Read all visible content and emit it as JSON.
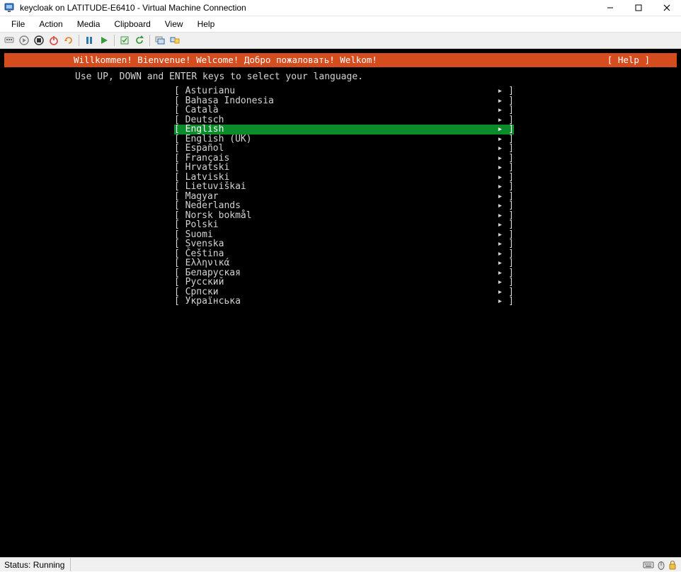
{
  "window": {
    "title": "keycloak on LATITUDE-E6410 - Virtual Machine Connection"
  },
  "menu": {
    "items": [
      "File",
      "Action",
      "Media",
      "Clipboard",
      "View",
      "Help"
    ]
  },
  "toolbar": {
    "icons": [
      "ctrl-alt-del",
      "start",
      "turnoff",
      "shutdown",
      "reset",
      "sep",
      "pause",
      "play",
      "sep",
      "checkpoint",
      "revert",
      "sep",
      "enhanced",
      "share"
    ]
  },
  "console": {
    "header_welcome": "Willkommen! Bienvenue! Welcome! Добро пожаловать! Welkom!",
    "header_help": "[ Help ]",
    "instruction": "Use UP, DOWN and ENTER keys to select your language.",
    "languages": [
      {
        "name": "Asturianu",
        "selected": false
      },
      {
        "name": "Bahasa Indonesia",
        "selected": false
      },
      {
        "name": "Català",
        "selected": false
      },
      {
        "name": "Deutsch",
        "selected": false
      },
      {
        "name": "English",
        "selected": true
      },
      {
        "name": "English (UK)",
        "selected": false
      },
      {
        "name": "Español",
        "selected": false
      },
      {
        "name": "Français",
        "selected": false
      },
      {
        "name": "Hrvatski",
        "selected": false
      },
      {
        "name": "Latviski",
        "selected": false
      },
      {
        "name": "Lietuviškai",
        "selected": false
      },
      {
        "name": "Magyar",
        "selected": false
      },
      {
        "name": "Nederlands",
        "selected": false
      },
      {
        "name": "Norsk bokmål",
        "selected": false
      },
      {
        "name": "Polski",
        "selected": false
      },
      {
        "name": "Suomi",
        "selected": false
      },
      {
        "name": "Svenska",
        "selected": false
      },
      {
        "name": "Čeština",
        "selected": false
      },
      {
        "name": "Ελληνικά",
        "selected": false
      },
      {
        "name": "Беларуская",
        "selected": false
      },
      {
        "name": "Русский",
        "selected": false
      },
      {
        "name": "Српски",
        "selected": false
      },
      {
        "name": "Українська",
        "selected": false
      }
    ]
  },
  "status": {
    "text": "Status: Running"
  },
  "colors": {
    "header_bg": "#d54c1e",
    "selected_bg": "#0a8c2b"
  }
}
